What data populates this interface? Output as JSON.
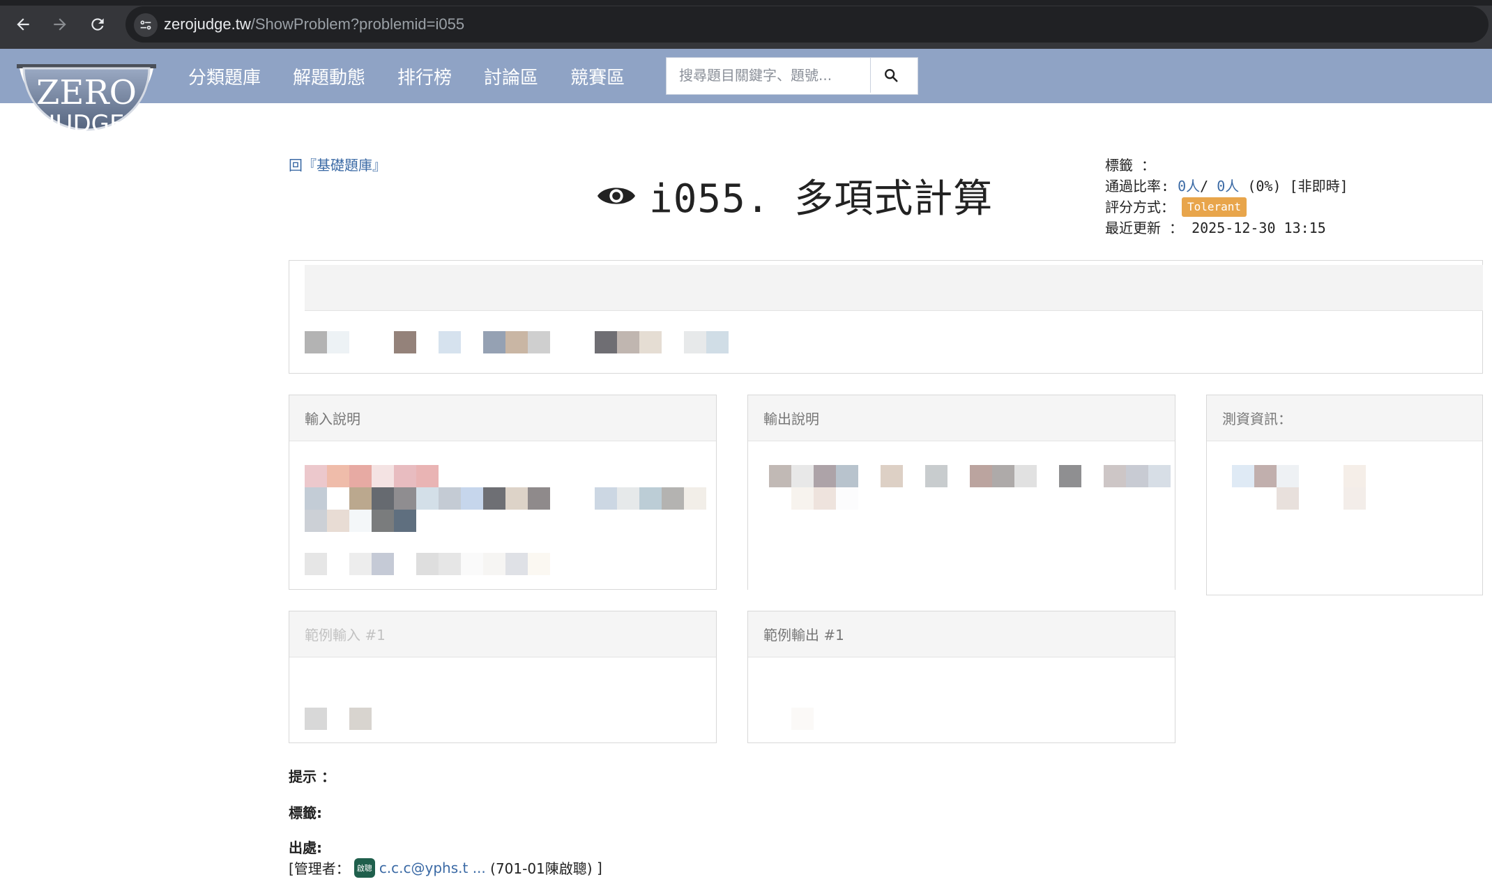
{
  "browser": {
    "url_host": "zerojudge.tw",
    "url_path": "/ShowProblem?problemid=i055"
  },
  "logo": {
    "line1": "ZERO",
    "line2": "JUDGE"
  },
  "nav": {
    "items": [
      "分類題庫",
      "解題動態",
      "排行榜",
      "討論區",
      "競賽區"
    ]
  },
  "search": {
    "placeholder": "搜尋題目關鍵字、題號..."
  },
  "problem": {
    "back_link": "回『基礎題庫』",
    "title": "i055. 多項式計算"
  },
  "meta": {
    "tags_label": "標籤 ：",
    "pass_rate_label": "通過比率:",
    "pass_accepted": "0人",
    "pass_sep": "/",
    "pass_total": "0人",
    "pass_percent": "(0%)",
    "pass_mode": "[非即時]",
    "judge_label": "評分方式：",
    "judge_value": "Tolerant",
    "updated_label": "最近更新 ：",
    "updated_value": "2025-12-30 13:15"
  },
  "panels": {
    "input_title": "輸入說明",
    "output_title": "輸出說明",
    "testdata_title": "測資資訊：",
    "sample_input_title": "範例輸入 #1",
    "sample_output_title": "範例輸出 #1"
  },
  "footer": {
    "hint_label": "提示 ：",
    "tags_label": "標籤:",
    "source_label": "出處:",
    "manager_prefix": "[管理者：",
    "manager_avatar": "啟聰",
    "manager_id": "c.c.c@yphs.t ...",
    "manager_name": "(701-01陳啟聰)",
    "manager_suffix": "]"
  },
  "colors": {
    "header_bg": "#8fa3c5",
    "link": "#3b6aa5",
    "badge": "#e8a54b"
  }
}
